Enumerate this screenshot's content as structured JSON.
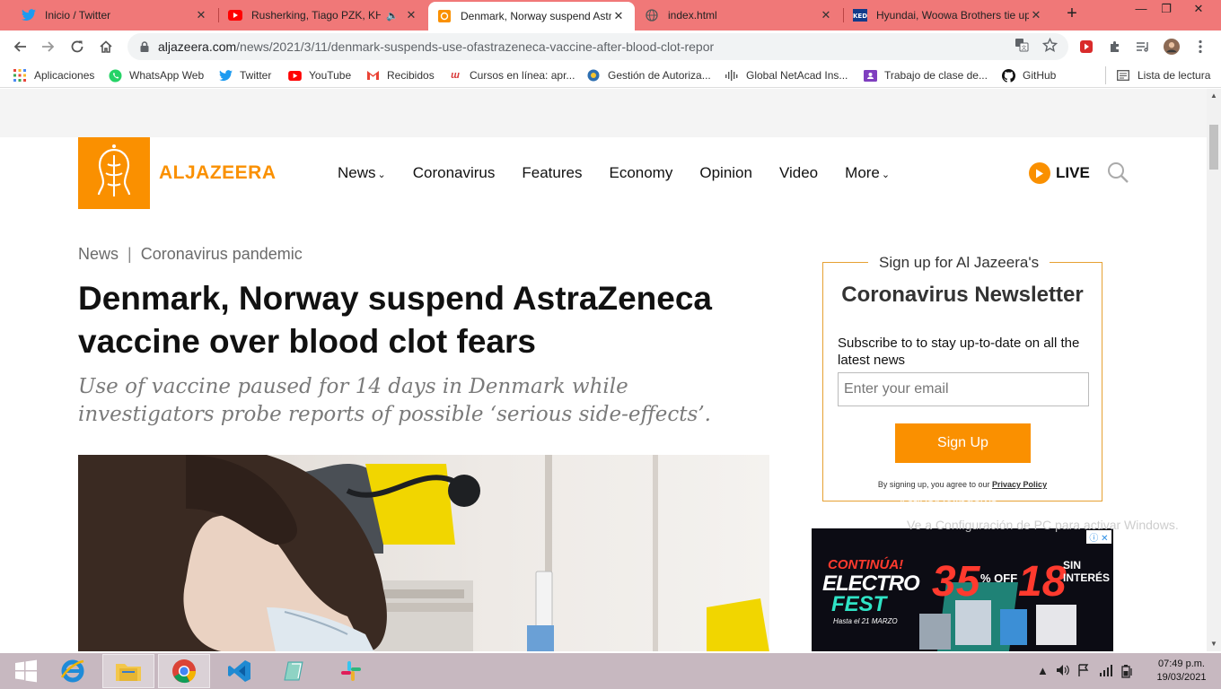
{
  "browser": {
    "tabs": [
      {
        "title": "Inicio / Twitter",
        "icon": "twitter-icon"
      },
      {
        "title": "Rusherking, Tiago PZK, KHEA",
        "icon": "youtube-icon"
      },
      {
        "title": "Denmark, Norway suspend AstraZeneca",
        "icon": "aljazeera-icon",
        "active": true
      },
      {
        "title": "index.html",
        "icon": "globe-icon"
      },
      {
        "title": "Hyundai, Woowa Brothers tie up",
        "icon": "ked-icon"
      }
    ],
    "new_tab_label": "+",
    "window_controls": {
      "minimize": "—",
      "restore": "❐",
      "close": "✕"
    },
    "url_host": "aljazeera.com",
    "url_path": "/news/2021/3/11/denmark-suspends-use-ofastrazeneca-vaccine-after-blood-clot-repor",
    "bookmarks": [
      {
        "label": "Aplicaciones",
        "icon": "apps-grid-icon"
      },
      {
        "label": "WhatsApp Web",
        "icon": "whatsapp-icon"
      },
      {
        "label": "Twitter",
        "icon": "twitter-icon"
      },
      {
        "label": "YouTube",
        "icon": "youtube-icon"
      },
      {
        "label": "Recibidos",
        "icon": "gmail-icon"
      },
      {
        "label": "Cursos en línea: apr...",
        "icon": "udemy-icon"
      },
      {
        "label": "Gestión de Autoriza...",
        "icon": "globe-icon"
      },
      {
        "label": "Global NetAcad Ins...",
        "icon": "cisco-icon"
      },
      {
        "label": "Trabajo de clase de...",
        "icon": "classroom-icon"
      },
      {
        "label": "GitHub",
        "icon": "github-icon"
      }
    ],
    "reading_list": "Lista de lectura"
  },
  "site": {
    "logo_text": "ALJAZEERA",
    "nav": [
      "News",
      "Coronavirus",
      "Features",
      "Economy",
      "Opinion",
      "Video",
      "More"
    ],
    "live_label": "LIVE"
  },
  "article": {
    "section": "News",
    "separator": "|",
    "topic": "Coronavirus pandemic",
    "headline": "Denmark, Norway suspend AstraZeneca vaccine over blood clot fears",
    "subheadline": "Use of vaccine paused for 14 days in Denmark while investigators probe reports of possible ‘serious side-effects’."
  },
  "newsletter": {
    "kicker": "Sign up for Al Jazeera's",
    "title": "Coronavirus Newsletter",
    "description": "Subscribe to to stay up-to-date on all the latest news",
    "email_placeholder": "Enter your email",
    "button": "Sign Up",
    "legal_prefix": "By signing up, you agree to our",
    "legal_link": "Privacy Policy"
  },
  "ad": {
    "line1": "CONTINÚA!",
    "line2": "ELECTRO",
    "line3": "FEST",
    "line4": "Hasta el 21 MARZO",
    "big1": "35",
    "off": "% OFF",
    "big2": "18",
    "sin": "SIN INTERÉS"
  },
  "watermark": {
    "line1": "Activar Windows",
    "line2": "Ve a Configuración de PC para activar Windows."
  },
  "taskbar": {
    "time": "07:49 p.m.",
    "date": "19/03/2021"
  },
  "colors": {
    "brand": "#fa9000",
    "tabstrip": "#f07878"
  }
}
